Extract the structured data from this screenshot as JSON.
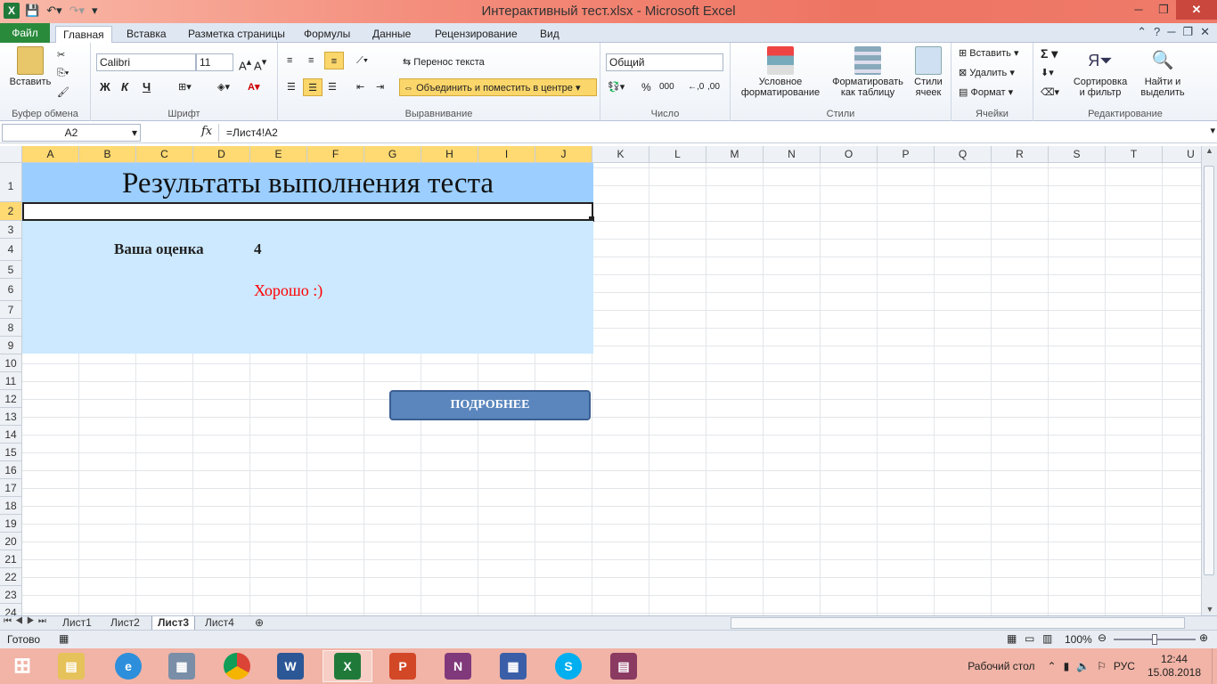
{
  "window": {
    "title": "Интерактивный тест.xlsx  -  Microsoft Excel"
  },
  "ribbon_tabs": [
    "Файл",
    "Главная",
    "Вставка",
    "Разметка страницы",
    "Формулы",
    "Данные",
    "Рецензирование",
    "Вид"
  ],
  "ribbon": {
    "clipboard": {
      "paste": "Вставить",
      "label": "Буфер обмена"
    },
    "font": {
      "name": "Calibri",
      "size": "11",
      "bold": "Ж",
      "italic": "К",
      "underline": "Ч",
      "label": "Шрифт"
    },
    "alignment": {
      "wrap": "Перенос текста",
      "merge": "Объединить и поместить в центре",
      "label": "Выравнивание"
    },
    "number": {
      "format": "Общий",
      "percent": "%",
      "thousands": "000",
      "label": "Число"
    },
    "styles": {
      "conditional_1": "Условное",
      "conditional_2": "форматирование",
      "table_1": "Форматировать",
      "table_2": "как таблицу",
      "cell_1": "Стили",
      "cell_2": "ячеек",
      "label": "Стили"
    },
    "cells": {
      "insert": "Вставить",
      "delete": "Удалить",
      "format": "Формат",
      "label": "Ячейки"
    },
    "editing": {
      "sum": "Σ",
      "sort_1": "Сортировка",
      "sort_2": "и фильтр",
      "find_1": "Найти и",
      "find_2": "выделить",
      "label": "Редактирование"
    }
  },
  "formula_bar": {
    "name_box": "A2",
    "fx": "fx",
    "formula": "=Лист4!A2"
  },
  "columns": [
    "A",
    "B",
    "C",
    "D",
    "E",
    "F",
    "G",
    "H",
    "I",
    "J",
    "K",
    "L",
    "M",
    "N",
    "O",
    "P",
    "Q",
    "R",
    "S",
    "T",
    "U"
  ],
  "rows": [
    "1",
    "2",
    "3",
    "4",
    "5",
    "6",
    "7",
    "8",
    "9",
    "10",
    "11",
    "12",
    "13",
    "14",
    "15",
    "16",
    "17",
    "18",
    "19",
    "20",
    "21",
    "22",
    "23",
    "24"
  ],
  "sheet": {
    "title": "Результаты выполнения теста",
    "grade_label": "Ваша оценка",
    "grade_value": "4",
    "grade_comment": "Хорошо :)",
    "details_button": "ПОДРОБНЕЕ"
  },
  "sheet_tabs": [
    "Лист1",
    "Лист2",
    "Лист3",
    "Лист4"
  ],
  "active_sheet": "Лист3",
  "status": {
    "ready": "Готово",
    "zoom": "100%"
  },
  "tray": {
    "desktop": "Рабочий стол",
    "lang": "РУС",
    "time": "12:44",
    "date": "15.08.2018"
  },
  "colors": {
    "title_band": "#9ccfff",
    "results_area": "#cce9ff",
    "comment_red": "#ff0000",
    "button_fill": "#5b86bd",
    "button_border": "#3a5f92"
  }
}
